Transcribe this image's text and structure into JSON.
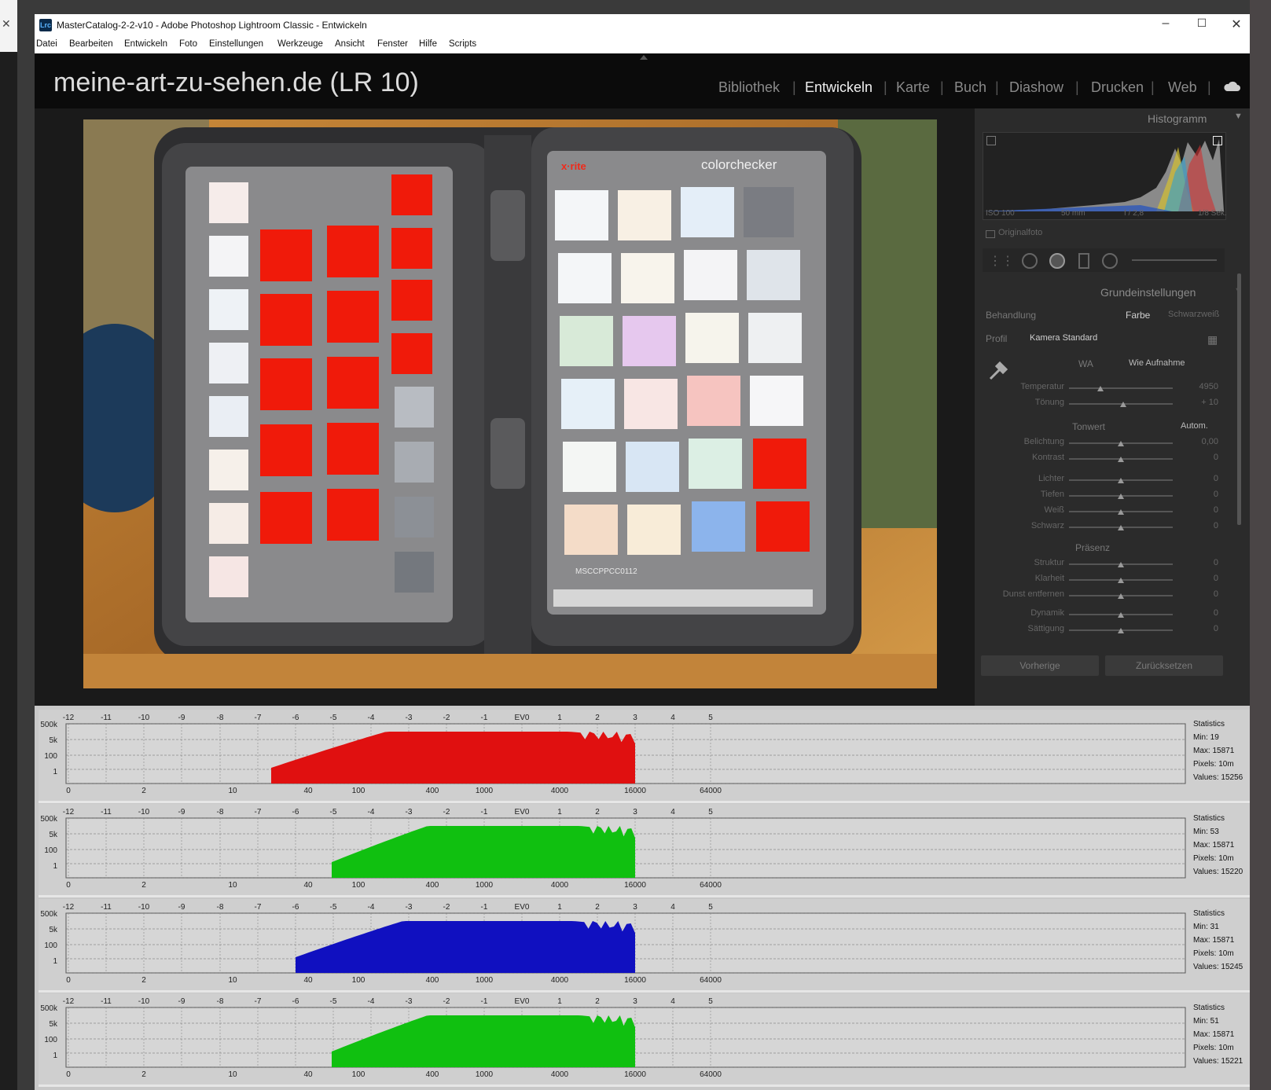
{
  "window": {
    "title": "MasterCatalog-2-2-v10 - Adobe Photoshop Lightroom Classic - Entwickeln",
    "app_icon": "Lrc",
    "minimize": "–",
    "maximize": "☐",
    "close": "✕",
    "behind_close": "✕"
  },
  "menu": [
    "Datei",
    "Bearbeiten",
    "Entwickeln",
    "Foto",
    "Einstellungen",
    "Werkzeuge",
    "Ansicht",
    "Fenster",
    "Hilfe",
    "Scripts"
  ],
  "identity_plate": "meine-art-zu-sehen.de (LR 10)",
  "modules": [
    "Bibliothek",
    "Entwickeln",
    "Karte",
    "Buch",
    "Diashow",
    "Drucken",
    "Web"
  ],
  "active_module": "Entwickeln",
  "photo": {
    "card_brand_left": "x·rite",
    "card_brand_right": "colorchecker",
    "card_label": "MSCCPPCC0112"
  },
  "histogram_panel": {
    "title": "Histogramm",
    "info": [
      "ISO 100",
      "50 mm",
      "f / 2,8",
      "1/8 Sek."
    ],
    "original_photo": "Originalfoto"
  },
  "basic_panel": {
    "title": "Grundeinstellungen",
    "treatment_label": "Behandlung",
    "treatment_color": "Farbe",
    "treatment_bw": "Schwarzweiß",
    "profile_label": "Profil",
    "profile_value": "Kamera Standard",
    "wb_label": "WA",
    "wb_value": "Wie Aufnahme",
    "sliders_wb": [
      {
        "label": "Temperatur",
        "value": "4950",
        "pos": 0.3
      },
      {
        "label": "Tönung",
        "value": "+ 10",
        "pos": 0.52
      }
    ],
    "tone_label": "Tonwert",
    "auto_label": "Autom.",
    "sliders_tone": [
      {
        "label": "Belichtung",
        "value": "0,00",
        "pos": 0.5
      },
      {
        "label": "Kontrast",
        "value": "0",
        "pos": 0.5
      },
      {
        "label": "Lichter",
        "value": "0",
        "pos": 0.5
      },
      {
        "label": "Tiefen",
        "value": "0",
        "pos": 0.5
      },
      {
        "label": "Weiß",
        "value": "0",
        "pos": 0.5
      },
      {
        "label": "Schwarz",
        "value": "0",
        "pos": 0.5
      }
    ],
    "presence_label": "Präsenz",
    "sliders_presence": [
      {
        "label": "Struktur",
        "value": "0",
        "pos": 0.5
      },
      {
        "label": "Klarheit",
        "value": "0",
        "pos": 0.5
      },
      {
        "label": "Dunst entfernen",
        "value": "0",
        "pos": 0.5
      },
      {
        "label": "Dynamik",
        "value": "0",
        "pos": 0.5
      },
      {
        "label": "Sättigung",
        "value": "0",
        "pos": 0.5
      }
    ],
    "prev_button": "Vorherige",
    "reset_button": "Zurücksetzen"
  },
  "raw_histograms": {
    "ev_ticks": [
      "-12",
      "-11",
      "-10",
      "-9",
      "-8",
      "-7",
      "-6",
      "-5",
      "-4",
      "-3",
      "-2",
      "-1",
      "EV0",
      "1",
      "2",
      "3",
      "4",
      "5"
    ],
    "value_ticks": [
      "0",
      "2",
      "10",
      "40",
      "100",
      "400",
      "1000",
      "4000",
      "16000",
      "64000"
    ],
    "y_ticks": [
      "500k",
      "5k",
      "100",
      "1"
    ],
    "channels": [
      {
        "color": "#e01010",
        "stats": [
          "Statistics",
          "Min: 19",
          "Max: 15871",
          "Pixels: 10m",
          "Values: 15256"
        ]
      },
      {
        "color": "#10c010",
        "stats": [
          "Statistics",
          "Min: 53",
          "Max: 15871",
          "Pixels: 10m",
          "Values: 15220"
        ]
      },
      {
        "color": "#1010c0",
        "stats": [
          "Statistics",
          "Min: 31",
          "Max: 15871",
          "Pixels: 10m",
          "Values: 15245"
        ]
      },
      {
        "color": "#10c010",
        "stats": [
          "Statistics",
          "Min: 51",
          "Max: 15871",
          "Pixels: 10m",
          "Values: 15221"
        ]
      }
    ]
  }
}
